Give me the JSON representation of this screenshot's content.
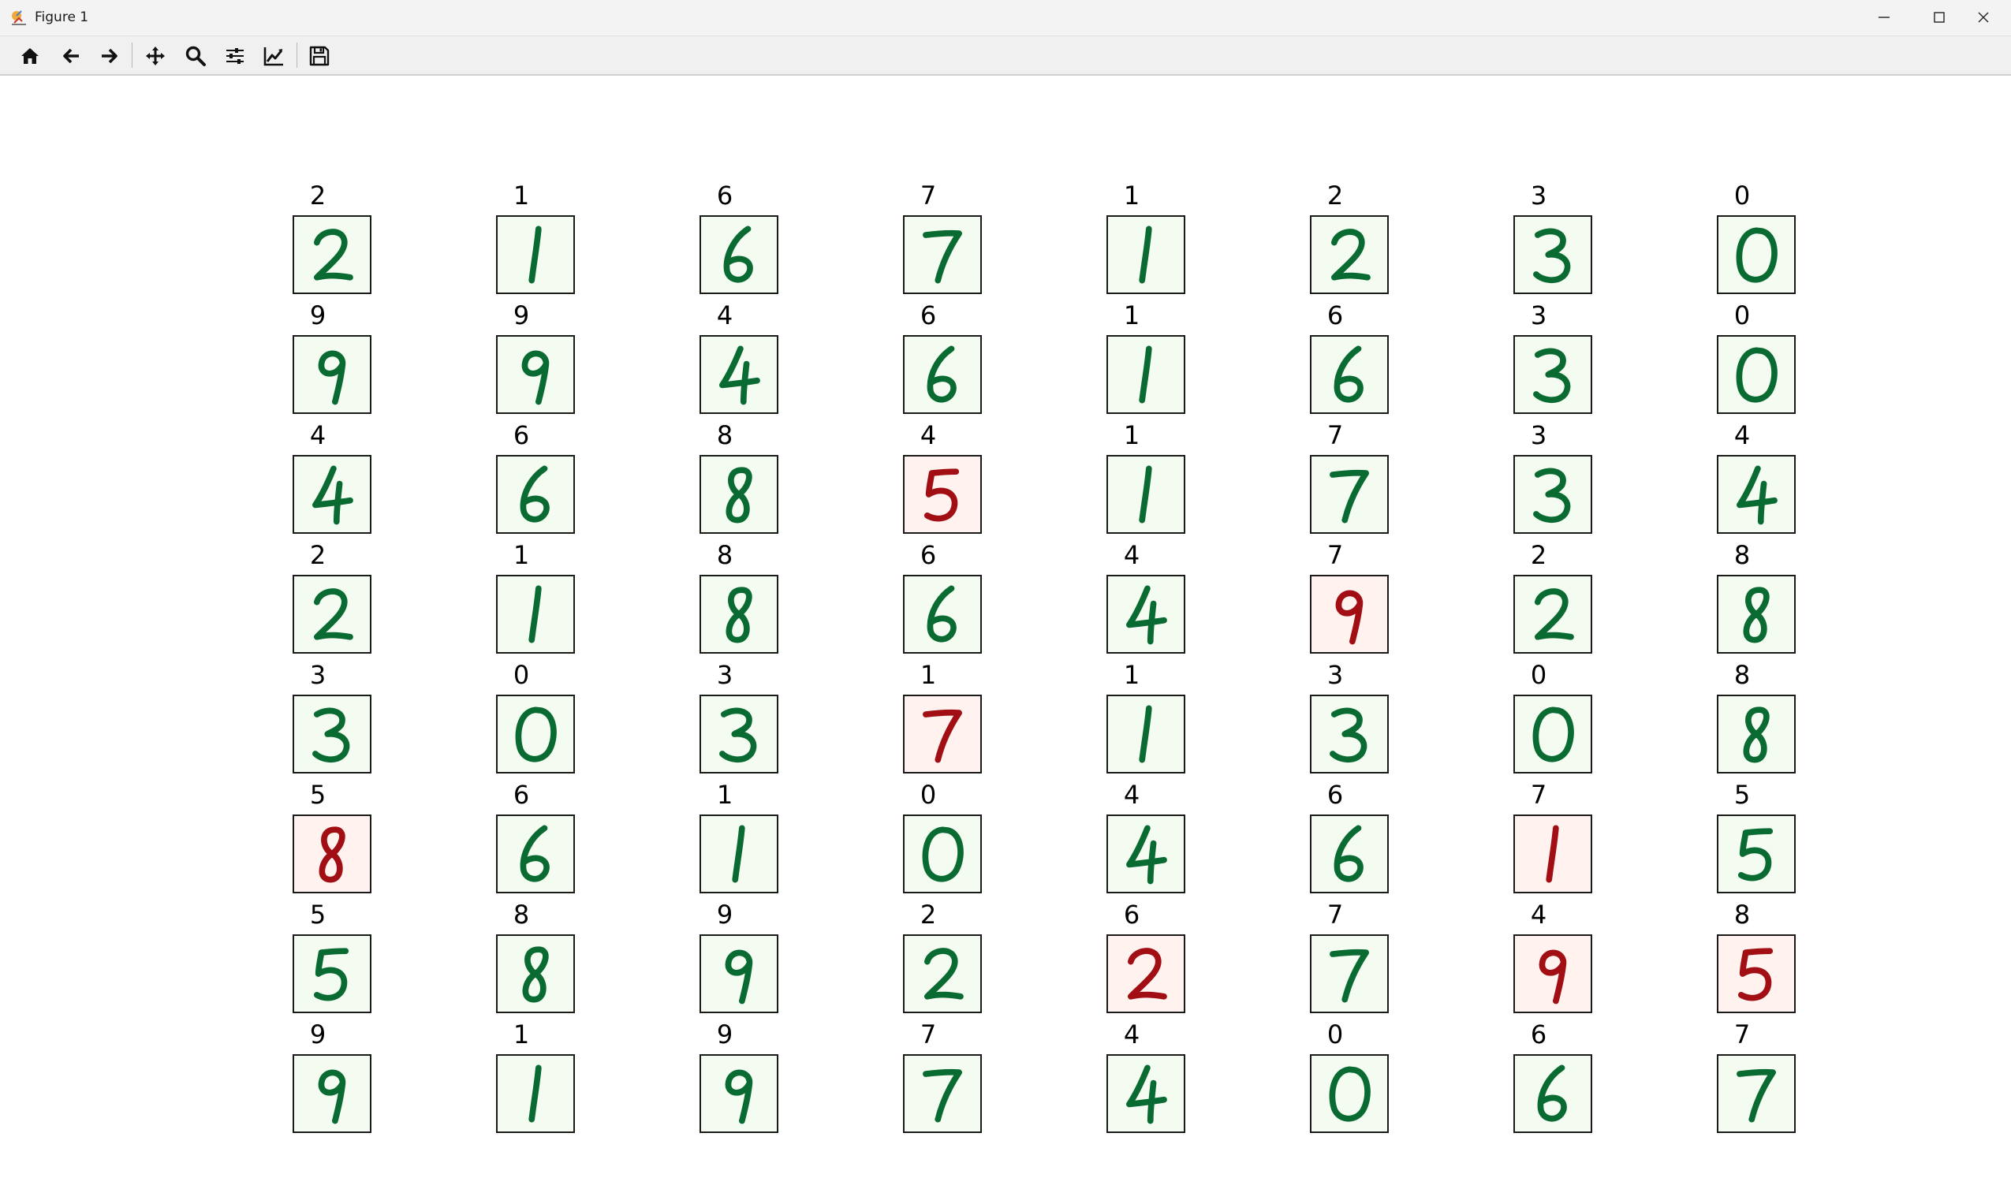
{
  "window": {
    "title": "Figure 1",
    "icon": "matplotlib-figure-icon"
  },
  "toolbar": {
    "tools": [
      {
        "name": "home-icon",
        "label": "Home"
      },
      {
        "name": "back-icon",
        "label": "Back"
      },
      {
        "name": "forward-icon",
        "label": "Forward"
      },
      {
        "name": "pan-icon",
        "label": "Pan"
      },
      {
        "name": "zoom-icon",
        "label": "Zoom"
      },
      {
        "name": "configure-subplots-icon",
        "label": "Configure subplots"
      },
      {
        "name": "edit-axis-icon",
        "label": "Edit axis"
      },
      {
        "name": "save-icon",
        "label": "Save"
      }
    ]
  },
  "colors": {
    "correct_ink": "#0a6b32",
    "correct_bg": "#f4fbf1",
    "wrong_ink": "#a10f14",
    "wrong_bg": "#fff2ef",
    "border": "#1a1a1a"
  },
  "grid": {
    "rows": 8,
    "cols": 8,
    "cells": [
      {
        "title": "2",
        "glyph": "2",
        "status": "correct"
      },
      {
        "title": "1",
        "glyph": "1",
        "status": "correct"
      },
      {
        "title": "6",
        "glyph": "6",
        "status": "correct"
      },
      {
        "title": "7",
        "glyph": "7",
        "status": "correct"
      },
      {
        "title": "1",
        "glyph": "1",
        "status": "correct"
      },
      {
        "title": "2",
        "glyph": "2",
        "status": "correct"
      },
      {
        "title": "3",
        "glyph": "3",
        "status": "correct"
      },
      {
        "title": "0",
        "glyph": "0",
        "status": "correct"
      },
      {
        "title": "9",
        "glyph": "9",
        "status": "correct"
      },
      {
        "title": "9",
        "glyph": "9",
        "status": "correct"
      },
      {
        "title": "4",
        "glyph": "4",
        "status": "correct"
      },
      {
        "title": "6",
        "glyph": "6",
        "status": "correct"
      },
      {
        "title": "1",
        "glyph": "1",
        "status": "correct"
      },
      {
        "title": "6",
        "glyph": "6",
        "status": "correct"
      },
      {
        "title": "3",
        "glyph": "3",
        "status": "correct"
      },
      {
        "title": "0",
        "glyph": "0",
        "status": "correct"
      },
      {
        "title": "4",
        "glyph": "4",
        "status": "correct"
      },
      {
        "title": "6",
        "glyph": "6",
        "status": "correct"
      },
      {
        "title": "8",
        "glyph": "8",
        "status": "correct"
      },
      {
        "title": "4",
        "glyph": "5",
        "status": "wrong"
      },
      {
        "title": "1",
        "glyph": "1",
        "status": "correct"
      },
      {
        "title": "7",
        "glyph": "7",
        "status": "correct"
      },
      {
        "title": "3",
        "glyph": "3",
        "status": "correct"
      },
      {
        "title": "4",
        "glyph": "4",
        "status": "correct"
      },
      {
        "title": "2",
        "glyph": "2",
        "status": "correct"
      },
      {
        "title": "1",
        "glyph": "1",
        "status": "correct"
      },
      {
        "title": "8",
        "glyph": "8",
        "status": "correct"
      },
      {
        "title": "6",
        "glyph": "6",
        "status": "correct"
      },
      {
        "title": "4",
        "glyph": "4",
        "status": "correct"
      },
      {
        "title": "7",
        "glyph": "9",
        "status": "wrong"
      },
      {
        "title": "2",
        "glyph": "2",
        "status": "correct"
      },
      {
        "title": "8",
        "glyph": "8",
        "status": "correct"
      },
      {
        "title": "3",
        "glyph": "3",
        "status": "correct"
      },
      {
        "title": "0",
        "glyph": "0",
        "status": "correct"
      },
      {
        "title": "3",
        "glyph": "3",
        "status": "correct"
      },
      {
        "title": "1",
        "glyph": "7",
        "status": "wrong"
      },
      {
        "title": "1",
        "glyph": "1",
        "status": "correct"
      },
      {
        "title": "3",
        "glyph": "3",
        "status": "correct"
      },
      {
        "title": "0",
        "glyph": "0",
        "status": "correct"
      },
      {
        "title": "8",
        "glyph": "8",
        "status": "correct"
      },
      {
        "title": "5",
        "glyph": "8",
        "status": "wrong"
      },
      {
        "title": "6",
        "glyph": "6",
        "status": "correct"
      },
      {
        "title": "1",
        "glyph": "1",
        "status": "correct"
      },
      {
        "title": "0",
        "glyph": "0",
        "status": "correct"
      },
      {
        "title": "4",
        "glyph": "4",
        "status": "correct"
      },
      {
        "title": "6",
        "glyph": "6",
        "status": "correct"
      },
      {
        "title": "7",
        "glyph": "1",
        "status": "wrong"
      },
      {
        "title": "5",
        "glyph": "5",
        "status": "correct"
      },
      {
        "title": "5",
        "glyph": "5",
        "status": "correct"
      },
      {
        "title": "8",
        "glyph": "8",
        "status": "correct"
      },
      {
        "title": "9",
        "glyph": "9",
        "status": "correct"
      },
      {
        "title": "2",
        "glyph": "2",
        "status": "correct"
      },
      {
        "title": "6",
        "glyph": "2",
        "status": "wrong"
      },
      {
        "title": "7",
        "glyph": "7",
        "status": "correct"
      },
      {
        "title": "4",
        "glyph": "9",
        "status": "wrong"
      },
      {
        "title": "8",
        "glyph": "5",
        "status": "wrong"
      },
      {
        "title": "9",
        "glyph": "9",
        "status": "correct"
      },
      {
        "title": "1",
        "glyph": "1",
        "status": "correct"
      },
      {
        "title": "9",
        "glyph": "9",
        "status": "correct"
      },
      {
        "title": "7",
        "glyph": "7",
        "status": "correct"
      },
      {
        "title": "4",
        "glyph": "4",
        "status": "correct"
      },
      {
        "title": "0",
        "glyph": "0",
        "status": "correct"
      },
      {
        "title": "6",
        "glyph": "6",
        "status": "correct"
      },
      {
        "title": "7",
        "glyph": "7",
        "status": "correct"
      }
    ]
  }
}
